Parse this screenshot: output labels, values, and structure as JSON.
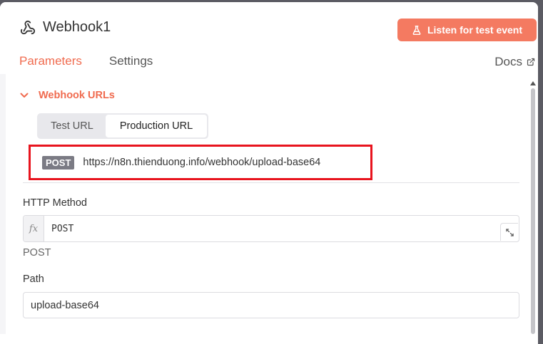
{
  "node": {
    "title": "Webhook1",
    "icon": "webhook-icon"
  },
  "header": {
    "listen_button_label": "Listen for test event",
    "listen_button_icon": "flask-icon",
    "docs_label": "Docs",
    "docs_icon": "external-link-icon"
  },
  "tabs": [
    {
      "label": "Parameters",
      "active": true
    },
    {
      "label": "Settings",
      "active": false
    }
  ],
  "webhook_urls": {
    "section_title": "Webhook URLs",
    "expanded": true,
    "toggle": {
      "test_label": "Test URL",
      "production_label": "Production URL",
      "selected": "Production URL"
    },
    "method_badge": "POST",
    "url": "https://n8n.thienduong.info/webhook/upload-base64"
  },
  "http_method": {
    "label": "HTTP Method",
    "fx_label": "fx",
    "expression_value": "POST",
    "resolved_preview": "POST"
  },
  "path": {
    "label": "Path",
    "value": "upload-base64"
  },
  "colors": {
    "accent": "#f06b4f",
    "button_bg": "#f47a61",
    "highlight_border": "#e8141e"
  }
}
